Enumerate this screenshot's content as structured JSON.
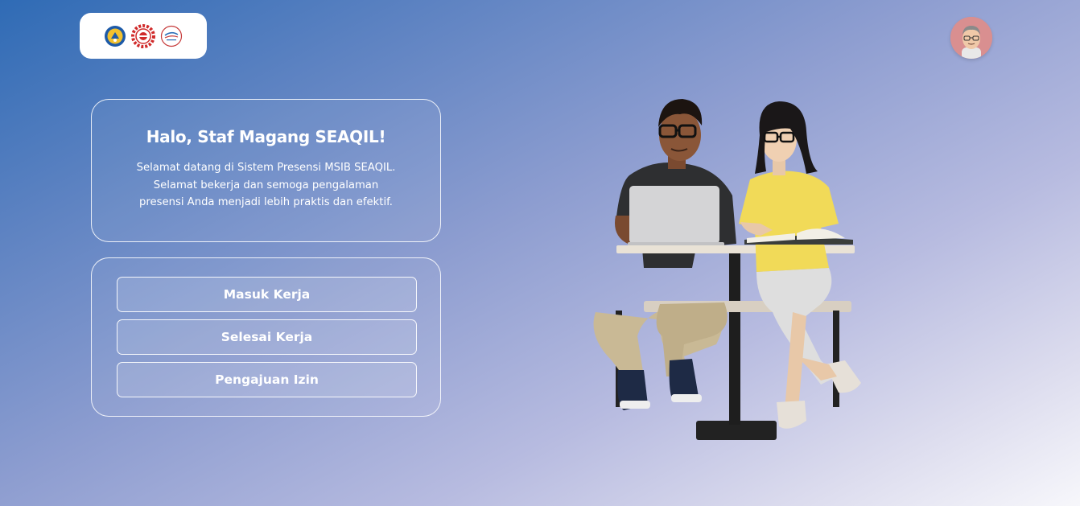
{
  "header": {
    "logos": [
      {
        "icon": "kemendikbud-logo-icon"
      },
      {
        "icon": "seameo-logo-icon"
      },
      {
        "icon": "seaqil-logo-icon"
      }
    ],
    "avatar_icon": "user-avatar-icon"
  },
  "welcome": {
    "title": "Halo, Staf Magang SEAQIL!",
    "line1": "Selamat datang di Sistem Presensi MSIB SEAQIL.",
    "line2": "Selamat bekerja dan semoga pengalaman",
    "line3": "presensi Anda menjadi lebih praktis dan efektif."
  },
  "actions": {
    "check_in": "Masuk Kerja",
    "check_out": "Selesai Kerja",
    "leave_request": "Pengajuan Izin"
  },
  "colors": {
    "gradient_start": "#2f6bb5",
    "gradient_end": "#f7f7fb",
    "text": "#ffffff"
  }
}
